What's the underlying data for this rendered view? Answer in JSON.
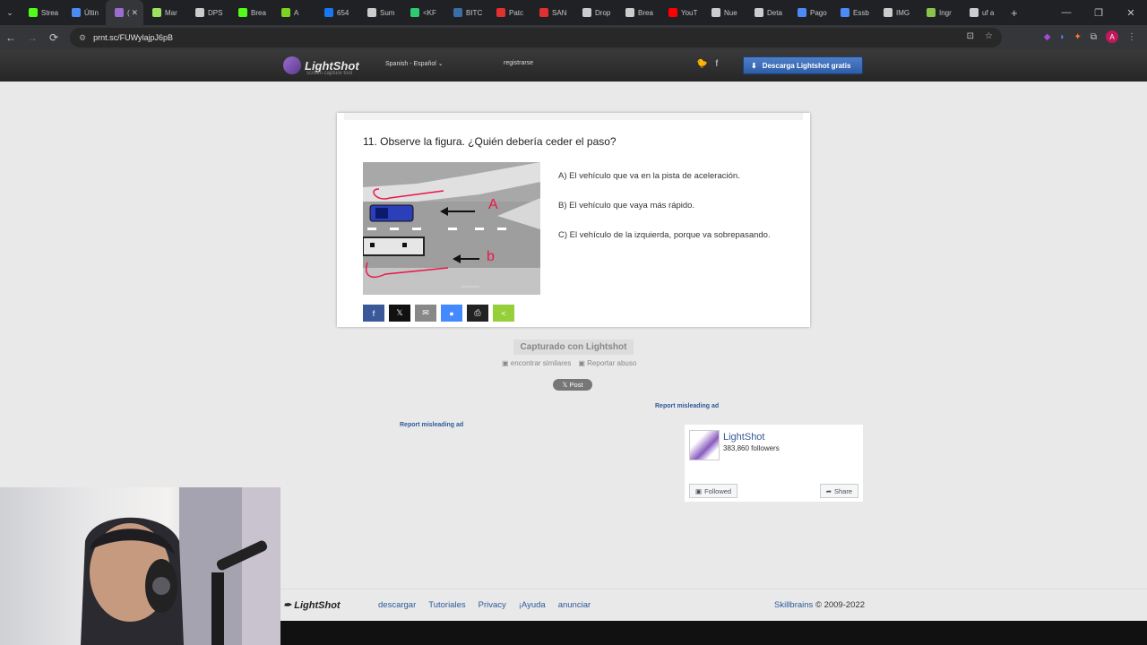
{
  "browser": {
    "tabs": [
      {
        "label": "Strea",
        "icon": "kick-icon",
        "color": "#53fc18"
      },
      {
        "label": "Últin",
        "icon": "doc-icon",
        "color": "#4c8bf5"
      },
      {
        "label": "(",
        "icon": "lightshot-icon",
        "color": "#9b6ccf",
        "active": true
      },
      {
        "label": "Mar",
        "icon": "star-icon",
        "color": "#a0e060"
      },
      {
        "label": "DPS",
        "icon": "globe-icon",
        "color": "#ccc"
      },
      {
        "label": "Brea",
        "icon": "kick-icon",
        "color": "#53fc18"
      },
      {
        "label": "A",
        "icon": "pen-icon",
        "color": "#7ed321"
      },
      {
        "label": "654",
        "icon": "facebook-icon",
        "color": "#1877f2"
      },
      {
        "label": "Sum",
        "icon": "globe-icon",
        "color": "#ccc"
      },
      {
        "label": "<KF",
        "icon": "plus-icon",
        "color": "#2ecc71"
      },
      {
        "label": "BITC",
        "icon": "sa-icon",
        "color": "#3a6ea5"
      },
      {
        "label": "Patc",
        "icon": "p-icon",
        "color": "#e03030"
      },
      {
        "label": "SAN",
        "icon": "bolt-icon",
        "color": "#e03030"
      },
      {
        "label": "Drop",
        "icon": "gem-icon",
        "color": "#ccc"
      },
      {
        "label": "Brea",
        "icon": "globe-icon",
        "color": "#ccc"
      },
      {
        "label": "YouT",
        "icon": "youtube-icon",
        "color": "#ff0000"
      },
      {
        "label": "Nue",
        "icon": "globe-icon",
        "color": "#ccc"
      },
      {
        "label": "Deta",
        "icon": "w-icon",
        "color": "#ccc"
      },
      {
        "label": "Pago",
        "icon": "cycle-icon",
        "color": "#4c8bf5"
      },
      {
        "label": "Essb",
        "icon": "grid-icon",
        "color": "#4c8bf5"
      },
      {
        "label": "IMG",
        "icon": "globe-icon",
        "color": "#ccc"
      },
      {
        "label": "Ingr",
        "icon": "image-icon",
        "color": "#8bc34a"
      },
      {
        "label": "uf a",
        "icon": "google-icon",
        "color": "#ccc"
      }
    ],
    "new_tab": "+",
    "minimize": "—",
    "restore": "❐",
    "close": "✕",
    "tab_close": "✕",
    "tab_menu": "⌄",
    "back": "←",
    "forward": "→",
    "reload": "⟳",
    "url": "prnt.sc/FUWylajpJ6pB",
    "site_info": "⚙",
    "install_icon": "⊡",
    "bookmark": "☆",
    "avatar": "A"
  },
  "lightshot": {
    "logo_name": "LightShot",
    "logo_sub": "screen capture tool",
    "language": "Spanish - Español",
    "register": "registrarse",
    "twitter": "🐦",
    "facebook": "f",
    "download_label": "Descarga Lightshot gratis",
    "question": "11. Observe la figura. ¿Quién debería ceder el paso?",
    "options": [
      "A) El vehículo que va en la pista de aceleración.",
      "B) El vehículo que vaya más rápido.",
      "C) El vehículo de la izquierda, porque va sobrepasando."
    ],
    "figure_labels": {
      "a": "A",
      "b": "b"
    },
    "share_buttons": [
      {
        "name": "facebook-share-button",
        "glyph": "f",
        "color": "#3b5998"
      },
      {
        "name": "x-share-button",
        "glyph": "𝕏",
        "color": "#111111"
      },
      {
        "name": "email-share-button",
        "glyph": "✉",
        "color": "#888888"
      },
      {
        "name": "messenger-share-button",
        "glyph": "●",
        "color": "#448aff"
      },
      {
        "name": "print-share-button",
        "glyph": "⎙",
        "color": "#222222"
      },
      {
        "name": "sharethis-share-button",
        "glyph": "<",
        "color": "#95d03a"
      }
    ],
    "captured": "Capturado con Lightshot",
    "find_similar": "encontrar similares",
    "report_abuse": "Reportar abuso",
    "post": "𝕏 Post",
    "report_ad_1": "Report misleading ad",
    "report_ad_2": "Report misleading ad",
    "fb_name": "LightShot",
    "fb_followers": "383,860 followers",
    "fb_followed": "Followed",
    "fb_share": "Share"
  },
  "footer": {
    "logo": "LightShot",
    "links": [
      "descargar",
      "Tutoriales",
      "Privacy",
      "¡Ayuda",
      "anunciar"
    ],
    "company": "Skillbrains",
    "copyright": "© 2009-2022"
  }
}
